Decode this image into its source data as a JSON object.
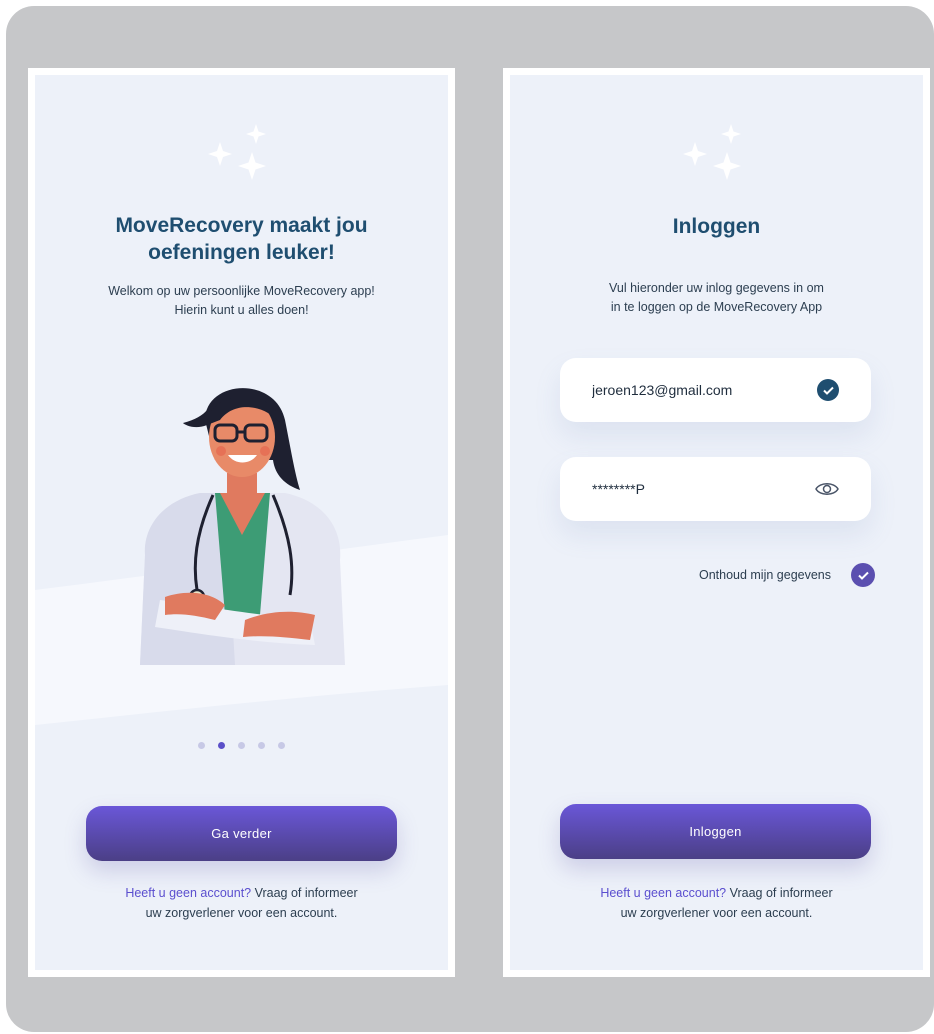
{
  "onboarding": {
    "title_line1": "MoveRecovery maakt jou",
    "title_line2": "oefeningen leuker!",
    "subtitle_line1": "Welkom op uw persoonlijke MoveRecovery app!",
    "subtitle_line2": "Hierin kunt u alles doen!",
    "page_indicator": {
      "total": 5,
      "active_index": 1
    },
    "button_label": "Ga verder",
    "footer_link": "Heeft u geen account?",
    "footer_text_1": " Vraag of informeer",
    "footer_text_2": "uw zorgverlener voor een account."
  },
  "login": {
    "title": "Inloggen",
    "subtitle_line1": "Vul hieronder uw inlog gegevens  in om",
    "subtitle_line2": "in te loggen op de MoveRecovery App",
    "email_value": "jeroen123@gmail.com",
    "password_value": "********P",
    "remember_label": "Onthoud mijn gegevens",
    "remember_checked": true,
    "button_label": "Inloggen",
    "footer_link": "Heeft u geen account?",
    "footer_text_1": " Vraag of informeer",
    "footer_text_2": "uw zorgverlener voor een account."
  },
  "colors": {
    "title": "#1f4e70",
    "accent": "#5b4fcf",
    "button_top": "#6a57d8",
    "button_bottom": "#4b3f86",
    "screen_bg": "#edf1f9"
  },
  "icons": {
    "sparkles": "sparkles-icon",
    "email_valid": "check-circle-icon",
    "password_toggle": "eye-icon",
    "remember": "check-circle-icon"
  }
}
